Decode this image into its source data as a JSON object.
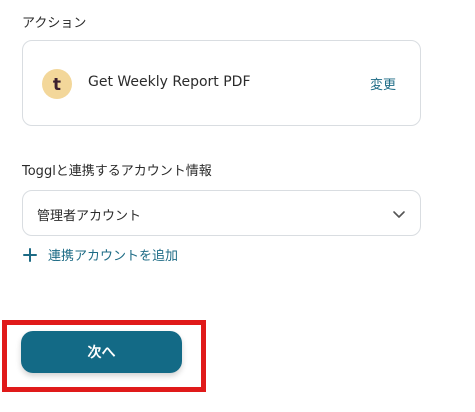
{
  "action_section": {
    "label": "アクション",
    "app_icon": {
      "name": "toggl-icon",
      "glyph": "t",
      "bg_color": "#f3d79a",
      "fg_color": "#3b1f2f"
    },
    "action_name": "Get Weekly Report PDF",
    "change_label": "変更"
  },
  "account_section": {
    "label": "Togglと連携するアカウント情報",
    "selected_account": "管理者アカウント",
    "add_account_label": "連携アカウントを追加"
  },
  "footer": {
    "next_label": "次へ",
    "highlight_color": "#e01a1a"
  },
  "colors": {
    "accent": "#1d6b85",
    "button_bg": "#136a86",
    "border": "#d9dde1"
  }
}
